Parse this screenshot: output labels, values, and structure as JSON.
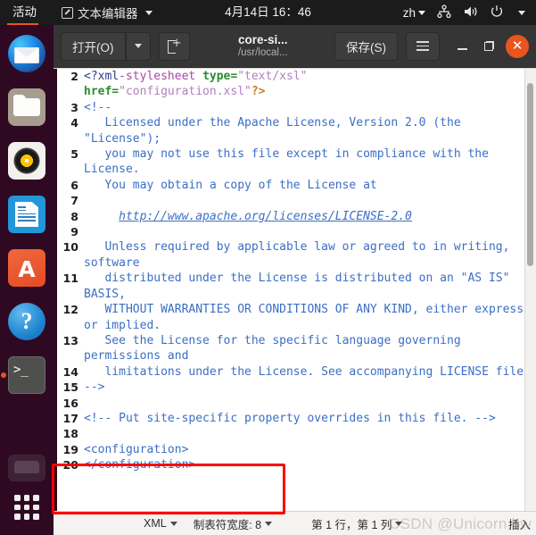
{
  "topbar": {
    "activities": "活动",
    "app_menu": {
      "icon": "text-editor-icon",
      "label": "文本编辑器"
    },
    "clock": "4月14日  16：46",
    "language": "zh",
    "tray_icons": [
      "network-wired-icon",
      "volume-icon",
      "power-icon",
      "chevron-down-icon"
    ]
  },
  "dock": {
    "items": [
      {
        "name": "thunderbird",
        "label": "Thunderbird 邮件"
      },
      {
        "name": "files",
        "label": "文件"
      },
      {
        "name": "rhythmbox",
        "label": "Rhythmbox 音乐"
      },
      {
        "name": "libreoffice",
        "label": "LibreOffice"
      },
      {
        "name": "ubuntu-software",
        "label": "Ubuntu 软件",
        "glyph": "A"
      },
      {
        "name": "help",
        "label": "帮助",
        "glyph": "?"
      },
      {
        "name": "terminal",
        "label": "终端",
        "glyph": ">_",
        "running": true
      },
      {
        "name": "trash",
        "label": "回收站"
      }
    ],
    "show_applications": "显示应用程序"
  },
  "window": {
    "toolbar": {
      "open_label": "打开(O)",
      "open_caret": "chevron-down-icon",
      "new_tab": "new-tab-icon",
      "save_label": "保存(S)",
      "menu": "hamburger-icon"
    },
    "title": "core-si...",
    "subtitle": "/usr/local...",
    "controls": {
      "minimize": "minimize-icon",
      "maximize": "maximize-icon",
      "close": "✕"
    }
  },
  "editor": {
    "lines": [
      {
        "num": "2",
        "parts": [
          {
            "t": "<?xml",
            "c": "tag"
          },
          {
            "t": "-stylesheet ",
            "c": "pi"
          },
          {
            "t": "type=",
            "c": "attr"
          },
          {
            "t": "\"text/xsl\"",
            "c": "str"
          },
          {
            "t": "\n",
            "c": "plain"
          },
          {
            "t": "href=",
            "c": "attr"
          },
          {
            "t": "\"configuration.xsl\"",
            "c": "str"
          },
          {
            "t": "?>",
            "c": "pi-end"
          }
        ]
      },
      {
        "num": "3",
        "parts": [
          {
            "t": "<!--",
            "c": "cmtmark"
          }
        ]
      },
      {
        "num": "4",
        "parts": [
          {
            "t": "   Licensed under the Apache License, Version 2.0 (the \"License\");",
            "c": "cmt"
          }
        ]
      },
      {
        "num": "5",
        "parts": [
          {
            "t": "   you may not use this file except in compliance with the License.",
            "c": "cmt"
          }
        ]
      },
      {
        "num": "6",
        "parts": [
          {
            "t": "   You may obtain a copy of the License at",
            "c": "cmt"
          }
        ]
      },
      {
        "num": "7",
        "parts": [
          {
            "t": "",
            "c": "cmt"
          }
        ]
      },
      {
        "num": "8",
        "parts": [
          {
            "t": "     ",
            "c": "cmt"
          },
          {
            "t": "http://www.apache.org/licenses/LICENSE-2.0",
            "c": "url"
          }
        ]
      },
      {
        "num": "9",
        "parts": [
          {
            "t": "",
            "c": "cmt"
          }
        ]
      },
      {
        "num": "10",
        "parts": [
          {
            "t": "   Unless required by applicable law or agreed to in writing, software",
            "c": "cmt"
          }
        ]
      },
      {
        "num": "11",
        "parts": [
          {
            "t": "   distributed under the License is distributed on an \"AS IS\" BASIS,",
            "c": "cmt"
          }
        ]
      },
      {
        "num": "12",
        "parts": [
          {
            "t": "   WITHOUT WARRANTIES OR CONDITIONS OF ANY KIND, either express or implied.",
            "c": "cmt"
          }
        ]
      },
      {
        "num": "13",
        "parts": [
          {
            "t": "   See the License for the specific language governing permissions and",
            "c": "cmt"
          }
        ]
      },
      {
        "num": "14",
        "parts": [
          {
            "t": "   limitations under the License. See accompanying LICENSE file.",
            "c": "cmt"
          }
        ]
      },
      {
        "num": "15",
        "parts": [
          {
            "t": "-->",
            "c": "cmtmark"
          }
        ]
      },
      {
        "num": "16",
        "parts": [
          {
            "t": "",
            "c": "plain"
          }
        ]
      },
      {
        "num": "17",
        "parts": [
          {
            "t": "<!-- Put site-specific property overrides in this file. -->",
            "c": "cmt"
          }
        ]
      },
      {
        "num": "18",
        "parts": [
          {
            "t": "",
            "c": "plain"
          }
        ]
      },
      {
        "num": "19",
        "parts": [
          {
            "t": "<configuration>",
            "c": "eltag"
          }
        ]
      },
      {
        "num": "20",
        "parts": [
          {
            "t": "</configuration>",
            "c": "eltag"
          }
        ]
      }
    ]
  },
  "statusbar": {
    "language": "XML",
    "tab_width": "制表符宽度: 8",
    "position": "第 1 行，第 1 列",
    "insert_mode": "插入"
  },
  "watermark": "CSDN @Unicorn.bw",
  "colors": {
    "accent": "#e95420",
    "close_button": "#e9551f",
    "annotation": "#fb0000",
    "titlebar": "#353535",
    "editor_bg": "#ffffff",
    "code_text": "#3b6ec6"
  }
}
